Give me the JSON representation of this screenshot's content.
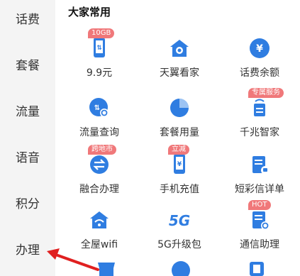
{
  "sidebar": {
    "items": [
      {
        "label": "话费"
      },
      {
        "label": "套餐"
      },
      {
        "label": "流量"
      },
      {
        "label": "语音"
      },
      {
        "label": "积分"
      },
      {
        "label": "办理"
      }
    ]
  },
  "section": {
    "title": "大家常用"
  },
  "grid": {
    "items": [
      {
        "label": "9.9元",
        "icon": "phone-data-icon",
        "badge": "10GB"
      },
      {
        "label": "天翼看家",
        "icon": "home-camera-icon",
        "badge": ""
      },
      {
        "label": "话费余额",
        "icon": "yuan-coin-icon",
        "badge": ""
      },
      {
        "label": "流量查询",
        "icon": "data-search-icon",
        "badge": ""
      },
      {
        "label": "套餐用量",
        "icon": "pie-chart-icon",
        "badge": ""
      },
      {
        "label": "千兆智家",
        "icon": "router-icon",
        "badge": "专属服务"
      },
      {
        "label": "融合办理",
        "icon": "exchange-icon",
        "badge": "跨地市"
      },
      {
        "label": "手机充值",
        "icon": "phone-recharge-icon",
        "badge": "立减"
      },
      {
        "label": "短彩信详单",
        "icon": "message-list-icon",
        "badge": ""
      },
      {
        "label": "全屋wifi",
        "icon": "home-wifi-icon",
        "badge": ""
      },
      {
        "label": "5G升级包",
        "icon": "5g-icon",
        "badge": ""
      },
      {
        "label": "通信助理",
        "icon": "assistant-doc-icon",
        "badge": "HOT"
      }
    ]
  },
  "colors": {
    "icon": "#2f7de1",
    "badge": "#f0787a",
    "sidebar_bg": "#f4f4f4",
    "arrow": "#e02020"
  }
}
